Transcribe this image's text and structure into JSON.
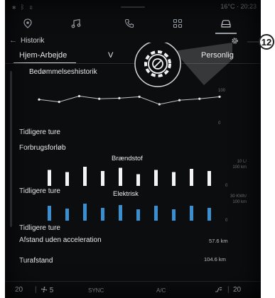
{
  "status": {
    "left_glyphs": "✱ ᛒ ▯",
    "right": "16°C · 20:23"
  },
  "nav": {
    "icons": [
      "location-pin-icon",
      "music-icon",
      "phone-icon",
      "apps-grid-icon",
      "car-icon"
    ]
  },
  "header": {
    "back": "←",
    "title": "Historik"
  },
  "tabs": {
    "items": [
      "Hjem-Arbejde",
      "V",
      "Personlig"
    ],
    "active": "Hjem-Arbejde"
  },
  "rating": {
    "title": "Bedømmelseshistorik",
    "y_top": "100",
    "y_bottom": "0",
    "link": "Tidligere ture"
  },
  "consumption": {
    "title": "Forbrugsforløb",
    "fuel": {
      "title": "Brændstof",
      "y_top": "10 L/\n100 km",
      "y_bottom": "0",
      "link": "Tidligere ture"
    },
    "electric": {
      "title": "Elektrisk",
      "y_top": "30 KWh/\n100 km",
      "y_bottom": "0",
      "link": "Tidligere ture"
    }
  },
  "distance_no_accel": {
    "label": "Afstand uden acceleration",
    "value": "57.6 km"
  },
  "trip_distance": {
    "label": "Turafstand",
    "value": "104.6 km"
  },
  "bottom": {
    "left_temp": "20",
    "fan": "5",
    "sync": "SYNC",
    "ac": "A/C",
    "right_temp": "20"
  },
  "callout": "12",
  "colors": {
    "screen_bg": "#0c0d0f",
    "fuel_bar": "#f4f4f4",
    "electric_bar": "#3a8fd0",
    "line": "#bfc3c8"
  },
  "chart_data": [
    {
      "type": "line",
      "title": "Bedømmelseshistorik",
      "x": [
        1,
        2,
        3,
        4,
        5,
        6,
        7,
        8,
        9,
        10
      ],
      "series": [
        {
          "values": [
            62,
            55,
            72,
            64,
            66,
            70,
            48,
            60,
            64,
            70
          ]
        }
      ],
      "ylim": [
        0,
        100
      ]
    },
    {
      "type": "bar",
      "title": "Brændstof",
      "categories": [
        "1",
        "2",
        "3",
        "4",
        "5",
        "6",
        "7",
        "8",
        "9",
        "10"
      ],
      "values": [
        7.5,
        6.5,
        9.0,
        7.0,
        8.5,
        5.5,
        7.5,
        6.5,
        8.0,
        7.0
      ],
      "ylabel": "10 L/100 km",
      "ylim": [
        0,
        10
      ]
    },
    {
      "type": "bar",
      "title": "Elektrisk",
      "categories": [
        "1",
        "2",
        "3",
        "4",
        "5",
        "6",
        "7",
        "8",
        "9",
        "10"
      ],
      "values": [
        21,
        17,
        24,
        18,
        22,
        16,
        21,
        16,
        21,
        18
      ],
      "ylabel": "30 KWh/100 km",
      "ylim": [
        0,
        30
      ]
    }
  ]
}
